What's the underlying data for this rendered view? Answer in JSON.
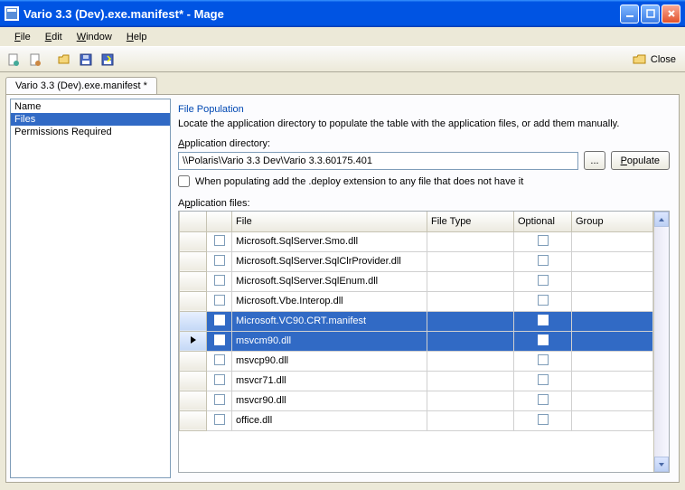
{
  "title": "Vario 3.3 (Dev).exe.manifest* - Mage",
  "menus": {
    "file": "File",
    "edit": "Edit",
    "window": "Window",
    "help": "Help"
  },
  "toolbar": {
    "close": "Close"
  },
  "tab": "Vario 3.3 (Dev).exe.manifest *",
  "sidebar": {
    "items": [
      "Name",
      "Files",
      "Permissions Required"
    ],
    "selected": 1
  },
  "main": {
    "section": "File Population",
    "desc": "Locate the application directory to populate the table with the application files, or add them manually.",
    "dir_label": "Application directory:",
    "dir_value": "\\\\Polaris\\Vario 3.3 Dev\\Vario 3.3.60175.401",
    "browse": "...",
    "populate": "Populate",
    "deploy_chk": "When populating add the .deploy extension to any file that does not have it",
    "files_label": "Application files:",
    "cols": {
      "file": "File",
      "filetype": "File Type",
      "optional": "Optional",
      "group": "Group"
    },
    "rows": [
      {
        "file": "Microsoft.SqlServer.Smo.dll",
        "sel": false,
        "cur": false
      },
      {
        "file": "Microsoft.SqlServer.SqlClrProvider.dll",
        "sel": false,
        "cur": false
      },
      {
        "file": "Microsoft.SqlServer.SqlEnum.dll",
        "sel": false,
        "cur": false
      },
      {
        "file": "Microsoft.Vbe.Interop.dll",
        "sel": false,
        "cur": false
      },
      {
        "file": "Microsoft.VC90.CRT.manifest",
        "sel": true,
        "cur": false
      },
      {
        "file": "msvcm90.dll",
        "sel": true,
        "cur": true
      },
      {
        "file": "msvcp90.dll",
        "sel": false,
        "cur": false
      },
      {
        "file": "msvcr71.dll",
        "sel": false,
        "cur": false
      },
      {
        "file": "msvcr90.dll",
        "sel": false,
        "cur": false
      },
      {
        "file": "office.dll",
        "sel": false,
        "cur": false
      }
    ]
  }
}
